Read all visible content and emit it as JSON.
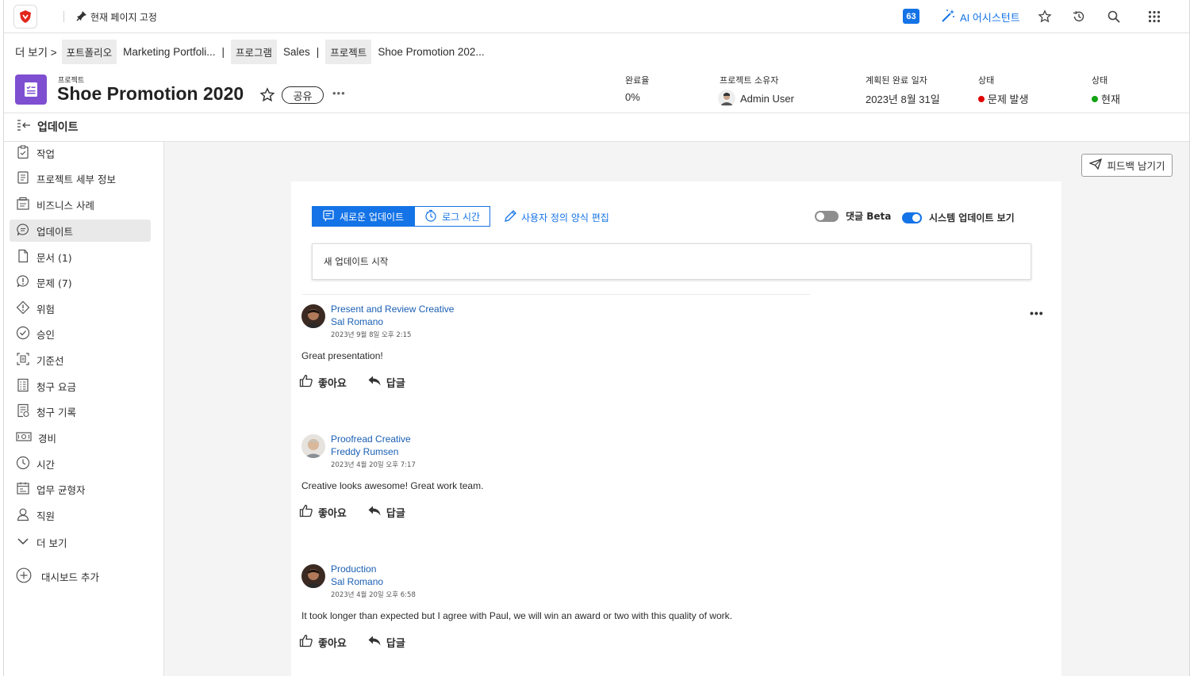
{
  "topbar": {
    "pin_label": "현재 페이지 고정",
    "notifications_count": "63",
    "ai_label": "AI 어시스턴트",
    "brand_color": "#e3261c",
    "accent_color": "#1473e6"
  },
  "breadcrumb": {
    "more": "더 보기 >",
    "portfolio_tag": "포트폴리오",
    "portfolio_name": "Marketing Portfoli...",
    "program_tag": "프로그램",
    "program_name": "Sales",
    "project_tag": "프로젝트",
    "project_name": "Shoe Promotion 202..."
  },
  "header": {
    "object_type": "프로젝트",
    "title": "Shoe Promotion 2020",
    "share_label": "공유",
    "more": "•••",
    "completion_label": "완료율",
    "completion_value": "0%",
    "owner_label": "프로젝트 소유자",
    "owner_value": "Admin User",
    "planned_label": "계획된 완료 일자",
    "planned_value": "2023년 8월 31일",
    "status1_label": "상태",
    "status1_value": "문제 발생",
    "status1_color": "#e00000",
    "status2_label": "상태",
    "status2_value": "현재",
    "status2_color": "#12a312"
  },
  "section": {
    "title": "업데이트"
  },
  "sidebar": {
    "items": [
      {
        "label": "작업",
        "icon": "task-icon"
      },
      {
        "label": "프로젝트 세부 정보",
        "icon": "details-icon"
      },
      {
        "label": "비즈니스 사례",
        "icon": "business-case-icon"
      },
      {
        "label": "업데이트",
        "icon": "updates-icon"
      },
      {
        "label": "문서 (1)",
        "icon": "document-icon"
      },
      {
        "label": "문제 (7)",
        "icon": "issue-icon"
      },
      {
        "label": "위험",
        "icon": "risk-icon"
      },
      {
        "label": "승인",
        "icon": "approval-icon"
      },
      {
        "label": "기준선",
        "icon": "baseline-icon"
      },
      {
        "label": "청구 요금",
        "icon": "billing-rates-icon"
      },
      {
        "label": "청구 기록",
        "icon": "billing-records-icon"
      },
      {
        "label": "경비",
        "icon": "expense-icon"
      },
      {
        "label": "시간",
        "icon": "clock-icon"
      },
      {
        "label": "업무 균형자",
        "icon": "workload-icon"
      },
      {
        "label": "직원",
        "icon": "people-icon"
      }
    ],
    "more_label": "더 보기",
    "add_dashboard_label": "대시보드 추가"
  },
  "main": {
    "feedback_label": "피드백 남기기",
    "tab_new_update": "새로운 업데이트",
    "tab_log_time": "로그 시간",
    "custom_form_edit": "사용자 정의 양식 편집",
    "toggle_comments_label": "댓글 Beta",
    "toggle_comments_on": false,
    "toggle_system_label": "시스템 업데이트 보기",
    "toggle_system_on": true,
    "new_update_placeholder": "새 업데이트 시작",
    "like_label": "좋아요",
    "reply_label": "답글"
  },
  "posts": [
    {
      "title": "Present and Review Creative",
      "author": "Sal Romano",
      "date": "2023년 9월 8일 오후 2:15",
      "body": "Great presentation!"
    },
    {
      "title": "Proofread Creative",
      "author": "Freddy Rumsen",
      "date": "2023년 4월 20일 오후 7:17",
      "body": "Creative looks awesome! Great work team."
    },
    {
      "title": "Production",
      "author": "Sal Romano",
      "date": "2023년 4월 20일 오후 6:58",
      "body": "It took longer than expected but I agree with Paul, we will win an award or two with this quality of work."
    }
  ]
}
